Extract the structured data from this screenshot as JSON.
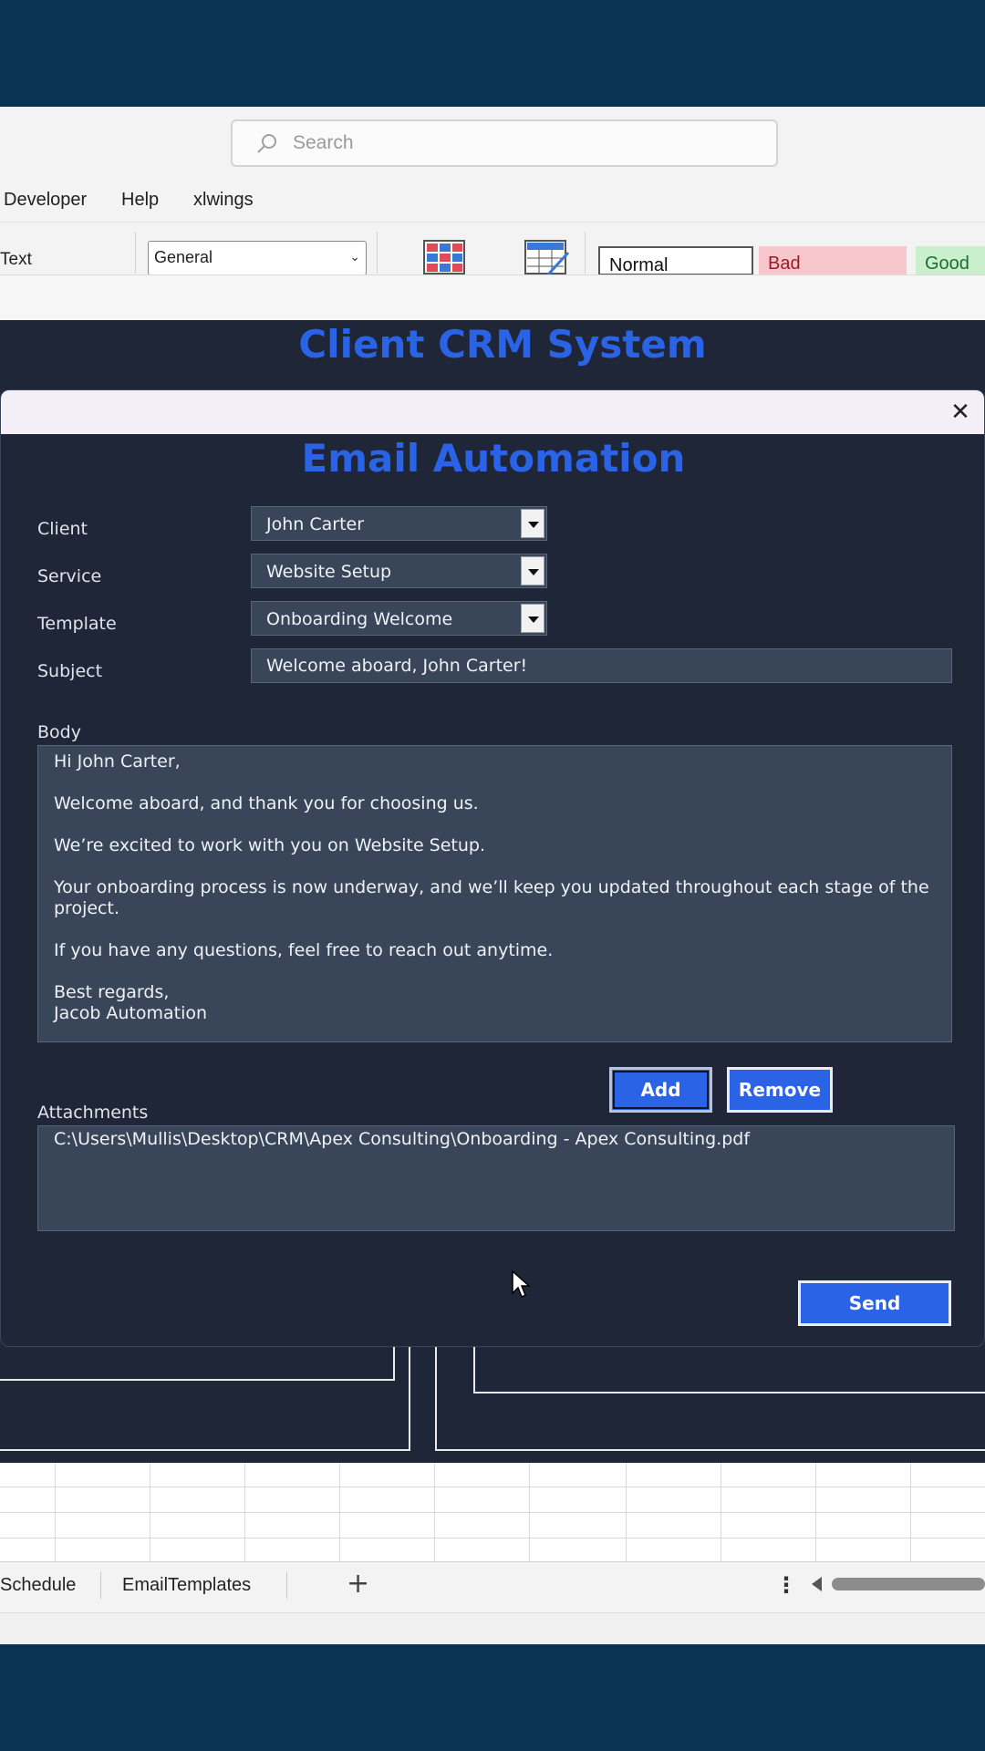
{
  "excel": {
    "search_placeholder": "Search",
    "menu": [
      "Developer",
      "Help",
      "xlwings"
    ],
    "ribbon_text": "Text",
    "number_format": "General",
    "styles": {
      "normal": "Normal",
      "bad": "Bad",
      "good": "Good"
    },
    "sheet_tabs": [
      "Schedule",
      "EmailTemplates"
    ],
    "add_sheet": "+",
    "more": "⋮"
  },
  "sheet_title": "Client CRM System",
  "dialog": {
    "title": "Email Automation",
    "close": "✕",
    "labels": {
      "client": "Client",
      "service": "Service",
      "template": "Template",
      "subject": "Subject",
      "body": "Body",
      "attachments": "Attachments"
    },
    "client": "John Carter",
    "service": "Website Setup",
    "template": "Onboarding Welcome",
    "subject": "Welcome aboard, John Carter!",
    "body": [
      "Hi John Carter,",
      "Welcome aboard, and thank you for choosing us.",
      "We’re excited to work with you on Website Setup.",
      "Your onboarding process is now underway, and we’ll keep you updated throughout each stage of the\nproject.",
      "If you have any questions, feel free to reach out anytime.",
      "Best regards,\nJacob Automation"
    ],
    "attachments": [
      "C:\\Users\\Mullis\\Desktop\\CRM\\Apex Consulting\\Onboarding - Apex Consulting.pdf"
    ],
    "buttons": {
      "add": "Add",
      "remove": "Remove",
      "send": "Send"
    }
  }
}
